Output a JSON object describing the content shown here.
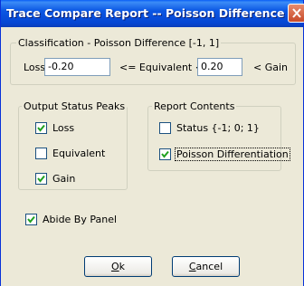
{
  "window": {
    "title": "Trace Compare Report -- Poisson Difference",
    "close_icon": "close-icon"
  },
  "classification": {
    "legend": "Classification - Poisson Difference [-1, 1]",
    "loss_label": "Loss <",
    "loss_value": "-0.20",
    "equiv_label": "<= Equivalent <=",
    "gain_value": "0.20",
    "gain_label": "< Gain"
  },
  "output_status_peaks": {
    "legend": "Output Status Peaks",
    "items": [
      {
        "label": "Loss",
        "checked": true
      },
      {
        "label": "Equivalent",
        "checked": false
      },
      {
        "label": "Gain",
        "checked": true
      }
    ]
  },
  "report_contents": {
    "legend": "Report Contents",
    "items": [
      {
        "label": "Status {-1; 0; 1}",
        "checked": false
      },
      {
        "label": "Poisson Differentiation",
        "checked": true
      }
    ]
  },
  "abide_by_panel": {
    "label": "Abide By Panel",
    "checked": true
  },
  "buttons": {
    "ok_first": "O",
    "ok_rest": "k",
    "cancel_first": "C",
    "cancel_rest": "ancel"
  },
  "colors": {
    "titlebar": "#0a56e3",
    "dialog_bg": "#ece9d8",
    "check_mark": "#21a121"
  }
}
